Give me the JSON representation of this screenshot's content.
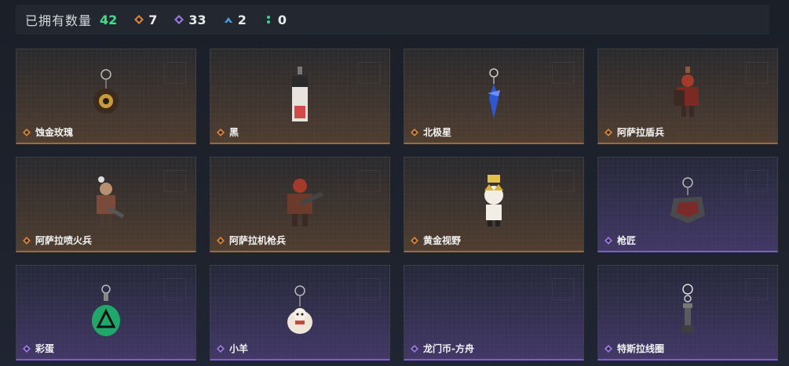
{
  "summary": {
    "label": "已拥有数量",
    "total": "42",
    "stats": [
      {
        "icon": "orange-diamond-icon",
        "value": "7",
        "color": "#d9823a"
      },
      {
        "icon": "purple-diamond-icon",
        "value": "33",
        "color": "#9a78e0"
      },
      {
        "icon": "blue-chevron-icon",
        "value": "2",
        "color": "#4aa3e6"
      },
      {
        "icon": "green-dots-icon",
        "value": "0",
        "color": "#3fd0a0"
      }
    ]
  },
  "colors": {
    "orange": "#d9823a",
    "purple": "#9a78e0",
    "accent_green": "#3fe08a"
  },
  "items": [
    {
      "name": "蚀金玫瑰",
      "rarity": "orange"
    },
    {
      "name": "黑",
      "rarity": "orange"
    },
    {
      "name": "北极星",
      "rarity": "orange"
    },
    {
      "name": "阿萨拉盾兵",
      "rarity": "orange"
    },
    {
      "name": "阿萨拉喷火兵",
      "rarity": "orange"
    },
    {
      "name": "阿萨拉机枪兵",
      "rarity": "orange"
    },
    {
      "name": "黄金视野",
      "rarity": "orange"
    },
    {
      "name": "枪匠",
      "rarity": "purple"
    },
    {
      "name": "彩蛋",
      "rarity": "purple"
    },
    {
      "name": "小羊",
      "rarity": "purple"
    },
    {
      "name": "龙门币-方舟",
      "rarity": "purple"
    },
    {
      "name": "特斯拉线圈",
      "rarity": "purple"
    }
  ]
}
